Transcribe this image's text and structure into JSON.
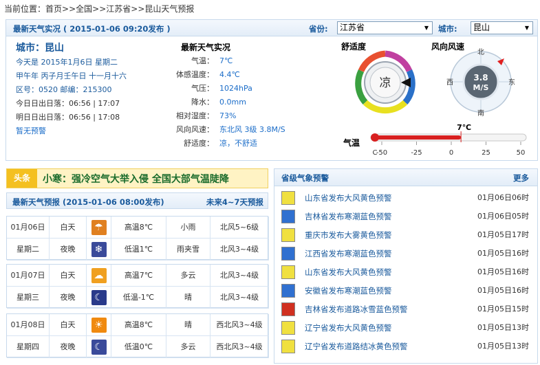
{
  "breadcrumb": [
    "当前位置：",
    "首页",
    ">>",
    "全国",
    ">>",
    "江苏省",
    ">>",
    "昆山天气预报"
  ],
  "realtime_panel": {
    "title": "最新天气实况 ( 2015-01-06  09:20发布 )",
    "province_label": "省份:",
    "province_value": "江苏省",
    "city_label": "城市:",
    "city_value": "昆山"
  },
  "city_info": {
    "city": "城市：昆山",
    "today": "今天是  2015年1月6日  星期二",
    "lunar": "甲午年  丙子月壬午日  十一月十六",
    "codes": "区号：0520   邮编：215300",
    "today_sun": "今日日出日落：06:56  |  17:07",
    "tomorrow_sun": "明日日出日落：06:56  |  17:08",
    "warning": "暂无预警"
  },
  "observation": {
    "title": "最新天气实况",
    "rows": [
      {
        "k": "气温：",
        "v": "7℃"
      },
      {
        "k": "体感温度：",
        "v": "4.4℃"
      },
      {
        "k": "气压：",
        "v": "1024hPa"
      },
      {
        "k": "降水：",
        "v": "0.0mm"
      },
      {
        "k": "相对湿度：",
        "v": "73%"
      },
      {
        "k": "风向风速：",
        "v": "东北风  3级  3.8M/S"
      },
      {
        "k": "舒适度：",
        "v": "凉，不舒适"
      }
    ]
  },
  "comfort_gauge": {
    "title": "舒适度",
    "value_label": "凉"
  },
  "wind_gauge": {
    "title": "风向风速",
    "speed": "3.8",
    "unit": "M/S",
    "n": "北",
    "s": "南",
    "e": "东",
    "w": "西"
  },
  "temp_bar": {
    "title": "气温",
    "value_label": "7℃",
    "value": 7,
    "min": -50,
    "max": 50,
    "ticks": [
      "C",
      "-50",
      "-25",
      "0",
      "25",
      "50"
    ]
  },
  "headline": {
    "tag": "头条",
    "text": "小寒：强冷空气大举入侵  全国大部气温陡降"
  },
  "forecast": {
    "title": "最新天气预报 (2015-01-06  08:00发布)",
    "more": "未来4~7天预报",
    "days": [
      {
        "date": "01月06日",
        "weekday": "星期二",
        "day": {
          "label": "白天",
          "icon": "rain-icon",
          "temp": "高温8℃",
          "weather": "小雨",
          "wind": "北风5~6级"
        },
        "night": {
          "label": "夜晚",
          "icon": "sleet-icon",
          "temp": "低温1℃",
          "weather": "雨夹雪",
          "wind": "北风3~4级"
        }
      },
      {
        "date": "01月07日",
        "weekday": "星期三",
        "day": {
          "label": "白天",
          "icon": "cloudy-icon",
          "temp": "高温7℃",
          "weather": "多云",
          "wind": "北风3~4级"
        },
        "night": {
          "label": "夜晚",
          "icon": "moon-icon",
          "temp": "低温-1℃",
          "weather": "晴",
          "wind": "北风3~4级"
        }
      },
      {
        "date": "01月08日",
        "weekday": "星期四",
        "day": {
          "label": "白天",
          "icon": "sun-icon",
          "temp": "高温8℃",
          "weather": "晴",
          "wind": "西北风3~4级"
        },
        "night": {
          "label": "夜晚",
          "icon": "moon-cloud-icon",
          "temp": "低温0℃",
          "weather": "多云",
          "wind": "西北风3~4级"
        }
      }
    ]
  },
  "warnings": {
    "title": "省级气象预警",
    "more": "更多",
    "items": [
      {
        "icon": "gale-yellow-icon",
        "color": "#f0e040",
        "text": "山东省发布大风黄色预警",
        "time": "01月06日06时"
      },
      {
        "icon": "cold-blue-icon",
        "color": "#3070d0",
        "text": "吉林省发布寒潮蓝色预警",
        "time": "01月06日05时"
      },
      {
        "icon": "fog-yellow-icon",
        "color": "#f0e040",
        "text": "重庆市发布大雾黄色预警",
        "time": "01月05日17时"
      },
      {
        "icon": "cold-blue-icon",
        "color": "#3070d0",
        "text": "江西省发布寒潮蓝色预警",
        "time": "01月05日16时"
      },
      {
        "icon": "gale-yellow-icon",
        "color": "#f0e040",
        "text": "山东省发布大风黄色预警",
        "time": "01月05日16时"
      },
      {
        "icon": "cold-blue-icon",
        "color": "#3070d0",
        "text": "安徽省发布寒潮蓝色预警",
        "time": "01月05日16时"
      },
      {
        "icon": "road-ice-icon",
        "color": "#d03020",
        "text": "吉林省发布道路冰雪蓝色预警",
        "time": "01月05日15时"
      },
      {
        "icon": "gale-yellow-icon",
        "color": "#f0e040",
        "text": "辽宁省发布大风黄色预警",
        "time": "01月05日13时"
      },
      {
        "icon": "road-ice-yellow-icon",
        "color": "#f0e040",
        "text": "辽宁省发布道路结冰黄色预警",
        "time": "01月05日13时"
      }
    ]
  }
}
